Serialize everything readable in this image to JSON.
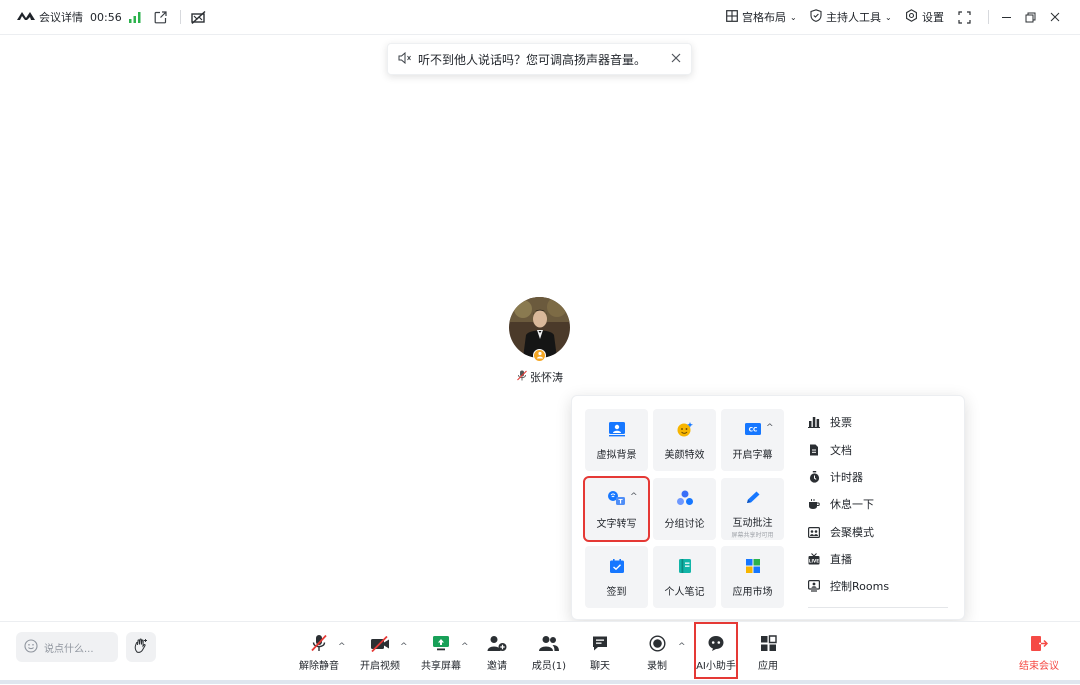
{
  "topbar": {
    "meeting_details": "会议详情",
    "timer": "00:56",
    "layout": "宫格布局",
    "host_tools": "主持人工具",
    "settings": "设置"
  },
  "toast": {
    "text": "听不到他人说话吗？您可调高扬声器音量。"
  },
  "participant": {
    "name": "张怀涛"
  },
  "panel": {
    "tiles": [
      {
        "label": "虚拟背景"
      },
      {
        "label": "美颜特效"
      },
      {
        "label": "开启字幕"
      },
      {
        "label": "文字转写"
      },
      {
        "label": "分组讨论"
      },
      {
        "label": "互动批注",
        "sub": "屏幕共享时可用"
      },
      {
        "label": "签到"
      },
      {
        "label": "个人笔记"
      },
      {
        "label": "应用市场"
      }
    ],
    "list": [
      {
        "label": "投票"
      },
      {
        "label": "文档"
      },
      {
        "label": "计时器"
      },
      {
        "label": "休息一下"
      },
      {
        "label": "会聚模式"
      },
      {
        "label": "直播"
      },
      {
        "label": "控制Rooms"
      }
    ]
  },
  "bottombar": {
    "chat_placeholder": "说点什么...",
    "tools": [
      {
        "label": "解除静音"
      },
      {
        "label": "开启视频"
      },
      {
        "label": "共享屏幕"
      },
      {
        "label": "邀请"
      },
      {
        "label": "成员(1)"
      },
      {
        "label": "聊天"
      },
      {
        "label": "录制"
      },
      {
        "label": "AI小助手"
      },
      {
        "label": "应用"
      }
    ],
    "end_meeting": "结束会议"
  },
  "colors": {
    "accent_blue": "#1677ff",
    "signal_green": "#2bb24c",
    "end_red": "#f54a45",
    "highlight_red": "#e53935"
  }
}
